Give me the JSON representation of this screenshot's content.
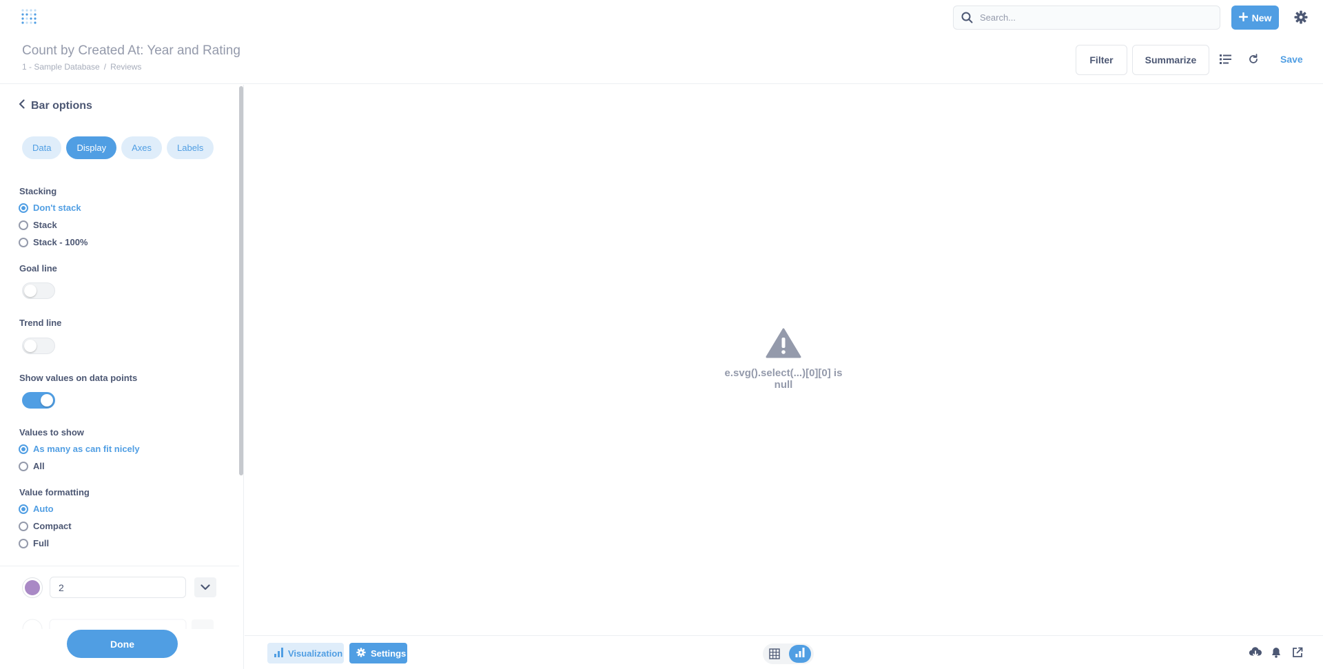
{
  "nav": {
    "search_placeholder": "Search...",
    "new_label": "New"
  },
  "header": {
    "title": "Count by Created At: Year and Rating",
    "breadcrumb": [
      "1 - Sample Database",
      "Reviews"
    ],
    "breadcrumb_sep": "/",
    "filter_label": "Filter",
    "summarize_label": "Summarize",
    "save_label": "Save"
  },
  "sidebar": {
    "heading": "Bar options",
    "tabs": [
      {
        "label": "Data",
        "active": false
      },
      {
        "label": "Display",
        "active": true
      },
      {
        "label": "Axes",
        "active": false
      },
      {
        "label": "Labels",
        "active": false
      }
    ],
    "stacking": {
      "label": "Stacking",
      "options": [
        "Don't stack",
        "Stack",
        "Stack - 100%"
      ],
      "selected": "Don't stack"
    },
    "goal_line": {
      "label": "Goal line",
      "on": false
    },
    "trend_line": {
      "label": "Trend line",
      "on": false
    },
    "show_values": {
      "label": "Show values on data points",
      "on": true
    },
    "values_to_show": {
      "label": "Values to show",
      "options": [
        "As many as can fit nicely",
        "All"
      ],
      "selected": "As many as can fit nicely"
    },
    "value_formatting": {
      "label": "Value formatting",
      "options": [
        "Auto",
        "Compact",
        "Full"
      ],
      "selected": "Auto"
    },
    "series": {
      "name": "2",
      "color": "#a989c5"
    },
    "done_label": "Done"
  },
  "main": {
    "error_text": "e.svg().select(...)[0][0] is null"
  },
  "footer": {
    "visualization_label": "Visualization",
    "settings_label": "Settings"
  },
  "colors": {
    "brand": "#509ee3",
    "text": "#4c5773",
    "muted": "#949aab"
  },
  "icons": [
    "metabase-logo-icon",
    "search-icon",
    "plus-icon",
    "gear-icon",
    "notebook-icon",
    "refresh-icon",
    "chevron-left-icon",
    "chevron-down-icon",
    "warning-icon",
    "bar-chart-icon",
    "table-icon",
    "download-icon",
    "bell-icon",
    "share-icon"
  ]
}
